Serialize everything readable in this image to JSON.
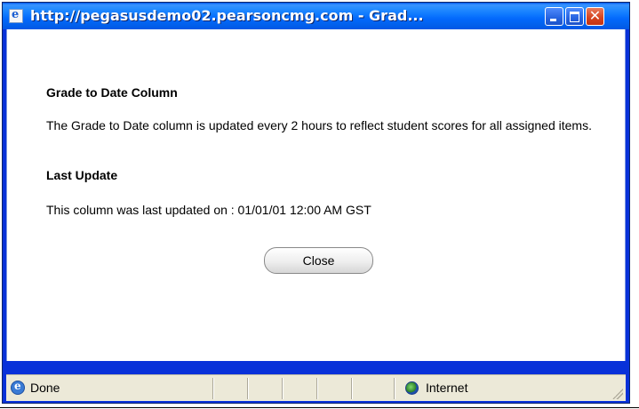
{
  "window": {
    "title": "http://pegasusdemo02.pearsoncmg.com - Grad..."
  },
  "dialog": {
    "heading": "Grade to Date Column",
    "description": "The Grade to Date column is updated every 2 hours to reflect student scores for all assigned items.",
    "update_heading": "Last Update",
    "update_text": "This column was last updated on : 01/01/01 12:00 AM GST",
    "close_label": "Close"
  },
  "statusbar": {
    "status": "Done",
    "zone": "Internet"
  }
}
